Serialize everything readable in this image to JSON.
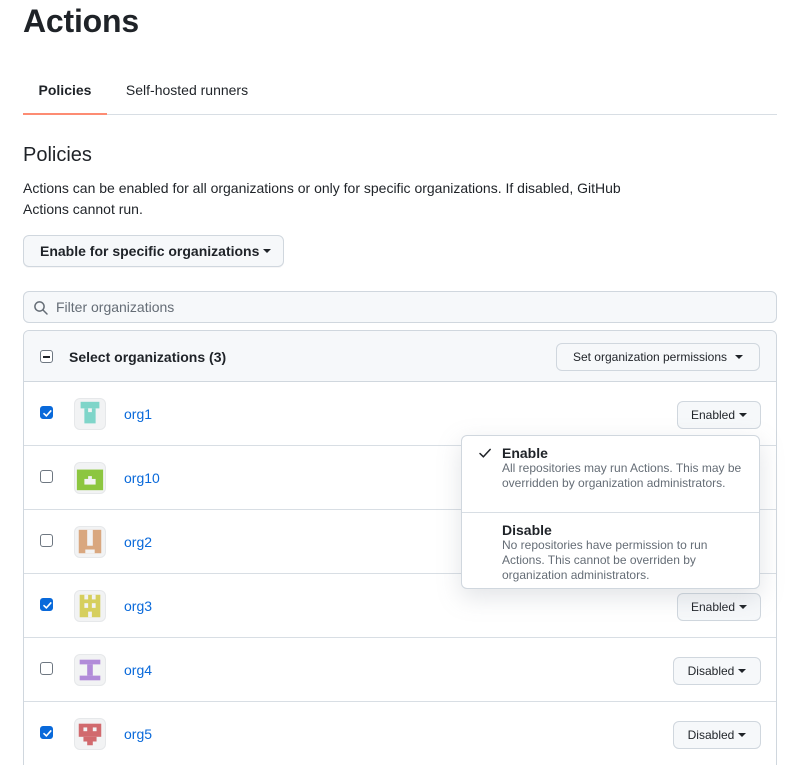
{
  "page": {
    "title": "Actions"
  },
  "tabs": [
    {
      "label": "Policies",
      "active": true
    },
    {
      "label": "Self-hosted runners",
      "active": false
    }
  ],
  "policies": {
    "title": "Policies",
    "description": "Actions can be enabled for all organizations or only for specific organizations. If disabled, GitHub Actions cannot run.",
    "enable_button": "Enable for specific organizations"
  },
  "filter": {
    "placeholder": "Filter organizations",
    "value": ""
  },
  "org_list": {
    "header_label": "Select organizations (3)",
    "permissions_button": "Set organization permissions",
    "rows": [
      {
        "name": "org1",
        "checked": true,
        "status": "Enabled"
      },
      {
        "name": "org10",
        "checked": false,
        "status": ""
      },
      {
        "name": "org2",
        "checked": false,
        "status": ""
      },
      {
        "name": "org3",
        "checked": true,
        "status": "Enabled"
      },
      {
        "name": "org4",
        "checked": false,
        "status": "Disabled"
      },
      {
        "name": "org5",
        "checked": true,
        "status": "Disabled"
      }
    ]
  },
  "menu": {
    "items": [
      {
        "title": "Enable",
        "description": "All repositories may run Actions. This may be overridden by organization administrators.",
        "selected": true
      },
      {
        "title": "Disable",
        "description": "No repositories have permission to run Actions. This cannot be overriden by organization administrators.",
        "selected": false
      }
    ]
  },
  "colors": {
    "link": "#0969da",
    "tab_underline": "#fd8c73",
    "checkbox": "#0969da",
    "avatar_org1": "#7fd5c9",
    "avatar_org10": "#8cc640",
    "avatar_org2": "#d9a77f",
    "avatar_org3": "#d6cf5e",
    "avatar_org4": "#b18ad9",
    "avatar_org5": "#d16a6e"
  }
}
